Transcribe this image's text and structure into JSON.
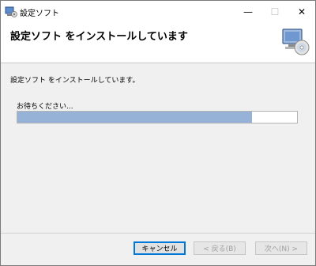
{
  "window": {
    "title": "設定ソフト",
    "controls": {
      "minimize": "—",
      "maximize": "☐",
      "close": "✕"
    }
  },
  "header": {
    "title": "設定ソフト をインストールしています",
    "icon": "setup-cd-computer-icon"
  },
  "body": {
    "status": "設定ソフト をインストールしています。",
    "wait_label": "お待ちください...",
    "progress_percent": 84
  },
  "buttons": {
    "cancel": "キャンセル",
    "back": "< 戻る(B)",
    "next": "次へ(N) >"
  },
  "colors": {
    "progress_fill": "#96b2d6",
    "accent": "#0078d7"
  }
}
